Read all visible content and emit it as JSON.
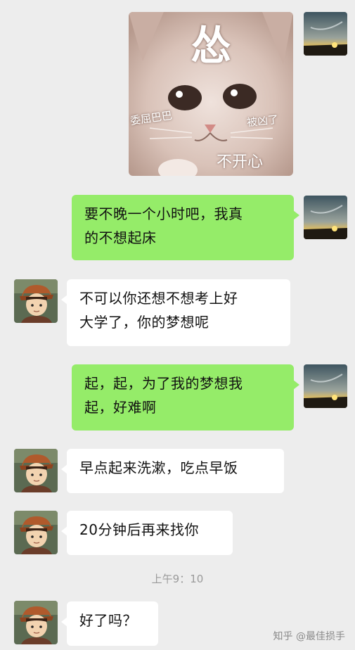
{
  "sticker": {
    "main_char": "怂",
    "left_caption": "委屈巴巴",
    "right_caption": "被凶了",
    "bottom_caption": "不开心"
  },
  "messages": [
    {
      "side": "me",
      "lines": [
        "要不晚一个小时吧，我真",
        "的不想起床"
      ]
    },
    {
      "side": "them",
      "lines": [
        "不可以你还想不想考上好",
        "大学了，你的梦想呢"
      ]
    },
    {
      "side": "me",
      "lines": [
        "起，起，为了我的梦想我",
        "起，好难啊"
      ]
    },
    {
      "side": "them",
      "lines": [
        "早点起来洗漱，吃点早饭"
      ]
    },
    {
      "side": "them",
      "lines": [
        "20分钟后再来找你"
      ]
    },
    {
      "side": "them",
      "lines": [
        "好了吗？"
      ]
    }
  ],
  "timestamp": "上午9：10",
  "watermark": "知乎 @最佳损手"
}
